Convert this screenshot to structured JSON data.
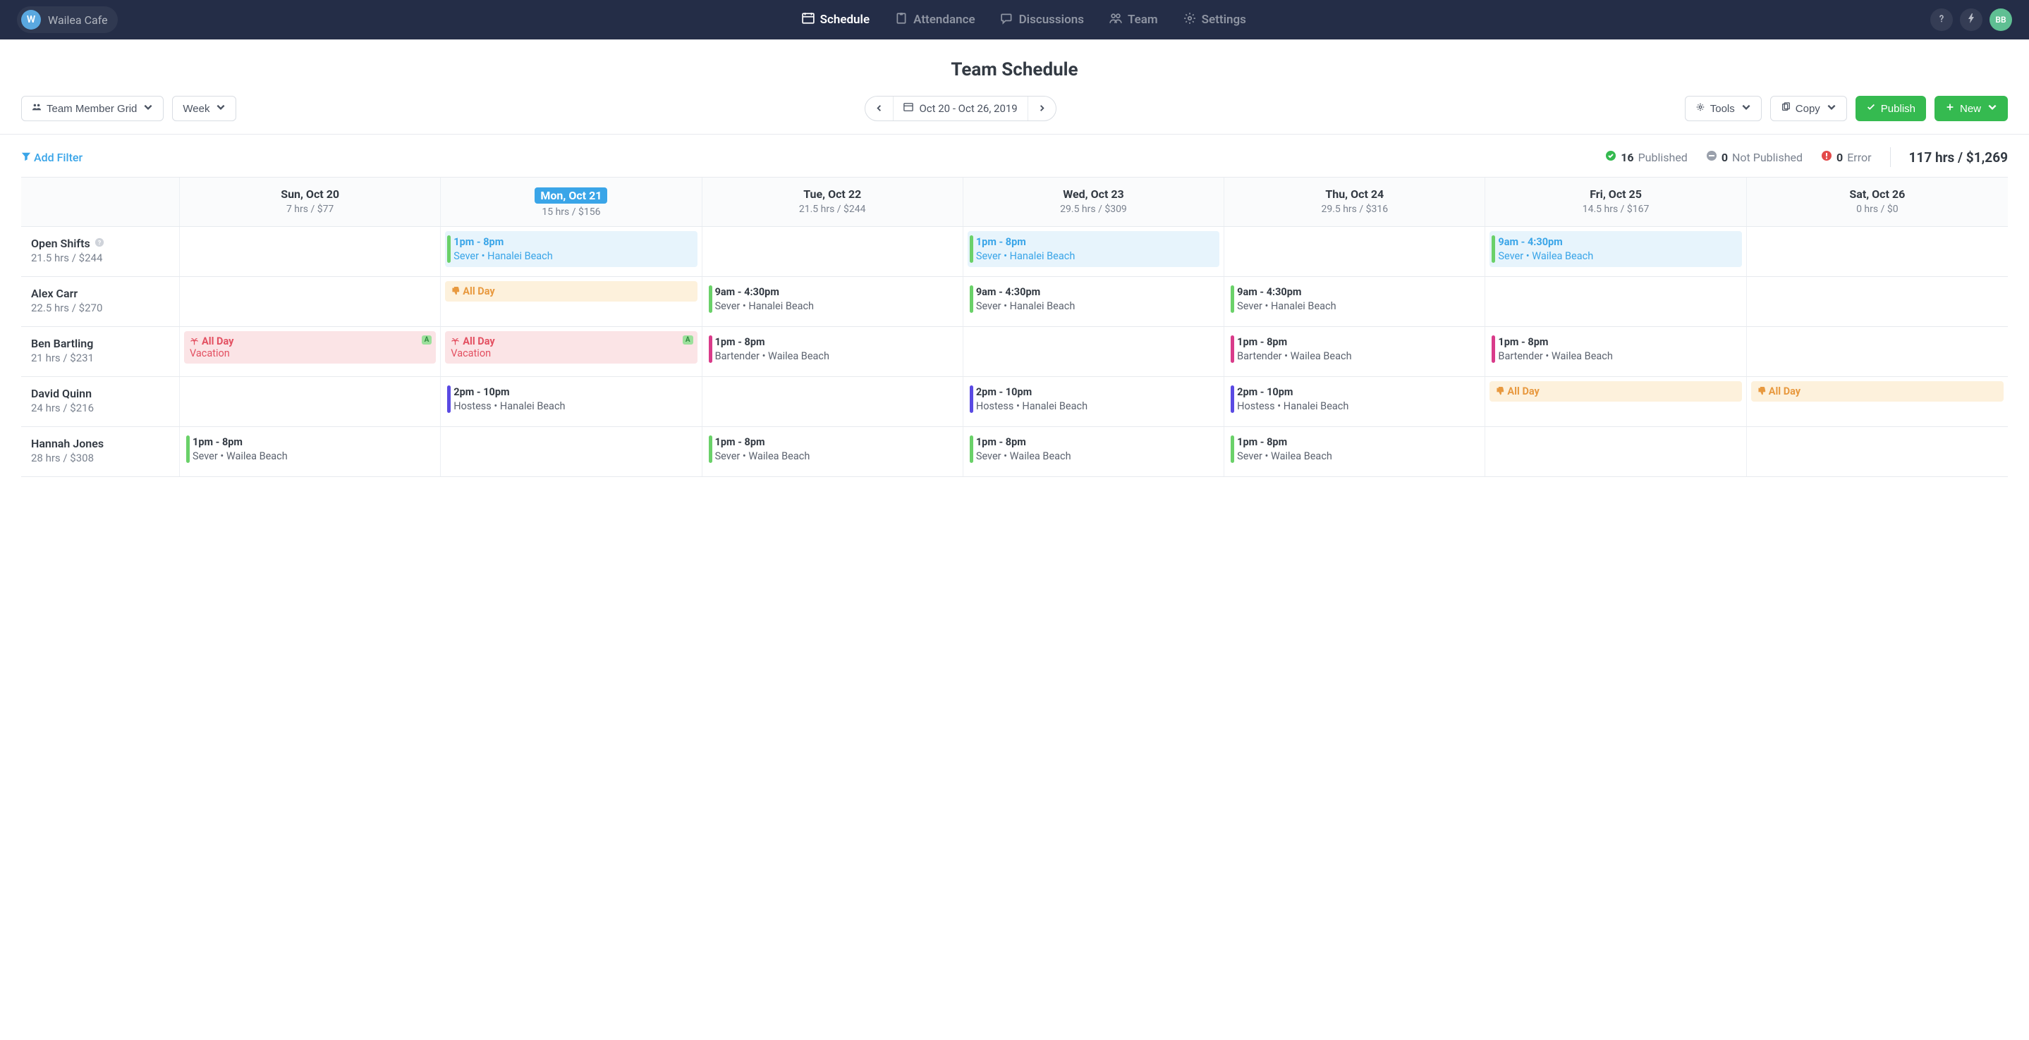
{
  "topbar": {
    "org_initial": "W",
    "org_name": "Wailea Cafe",
    "nav": {
      "schedule": "Schedule",
      "attendance": "Attendance",
      "discussions": "Discussions",
      "team": "Team",
      "settings": "Settings"
    },
    "user_initials": "BB"
  },
  "page": {
    "title": "Team Schedule"
  },
  "toolbar": {
    "view_mode": "Team Member Grid",
    "period": "Week",
    "date_range": "Oct 20 - Oct 26, 2019",
    "tools": "Tools",
    "copy": "Copy",
    "publish": "Publish",
    "new": "New"
  },
  "filter": {
    "add_filter": "Add Filter"
  },
  "stats": {
    "published_n": "16",
    "published_label": "Published",
    "not_published_n": "0",
    "not_published_label": "Not Published",
    "error_n": "0",
    "error_label": "Error",
    "totals": "117 hrs / $1,269"
  },
  "days": [
    {
      "label": "Sun, Oct 20",
      "stat": "7 hrs / $77",
      "today": false
    },
    {
      "label": "Mon, Oct 21",
      "stat": "15 hrs / $156",
      "today": true
    },
    {
      "label": "Tue, Oct 22",
      "stat": "21.5 hrs / $244",
      "today": false
    },
    {
      "label": "Wed, Oct 23",
      "stat": "29.5 hrs / $309",
      "today": false
    },
    {
      "label": "Thu, Oct 24",
      "stat": "29.5 hrs / $316",
      "today": false
    },
    {
      "label": "Fri, Oct 25",
      "stat": "14.5 hrs / $167",
      "today": false
    },
    {
      "label": "Sat, Oct 26",
      "stat": "0 hrs / $0",
      "today": false
    }
  ],
  "rows": [
    {
      "name": "Open Shifts",
      "help": true,
      "sub": "21.5 hrs / $244",
      "cells": [
        null,
        {
          "type": "open",
          "bar": "green",
          "time": "1pm - 8pm",
          "detail": "Sever • Hanalei Beach"
        },
        null,
        {
          "type": "open",
          "bar": "green",
          "time": "1pm - 8pm",
          "detail": "Sever • Hanalei Beach"
        },
        null,
        {
          "type": "open",
          "bar": "green",
          "time": "9am - 4:30pm",
          "detail": "Sever • Wailea Beach"
        },
        null
      ]
    },
    {
      "name": "Alex Carr",
      "sub": "22.5 hrs / $270",
      "cells": [
        null,
        {
          "type": "off",
          "time": "All Day"
        },
        {
          "type": "normal",
          "bar": "green",
          "time": "9am - 4:30pm",
          "detail": "Sever • Hanalei Beach"
        },
        {
          "type": "normal",
          "bar": "green",
          "time": "9am - 4:30pm",
          "detail": "Sever • Hanalei Beach"
        },
        {
          "type": "normal",
          "bar": "green",
          "time": "9am - 4:30pm",
          "detail": "Sever • Hanalei Beach"
        },
        null,
        null
      ]
    },
    {
      "name": "Ben Bartling",
      "sub": "21 hrs / $231",
      "cells": [
        {
          "type": "vac",
          "time": "All Day",
          "detail": "Vacation",
          "badge": "A"
        },
        {
          "type": "vac",
          "time": "All Day",
          "detail": "Vacation",
          "badge": "A"
        },
        {
          "type": "normal",
          "bar": "magenta",
          "time": "1pm - 8pm",
          "detail": "Bartender • Wailea Beach"
        },
        null,
        {
          "type": "normal",
          "bar": "magenta",
          "time": "1pm - 8pm",
          "detail": "Bartender • Wailea Beach"
        },
        {
          "type": "normal",
          "bar": "magenta",
          "time": "1pm - 8pm",
          "detail": "Bartender • Wailea Beach"
        },
        null
      ]
    },
    {
      "name": "David Quinn",
      "sub": "24 hrs / $216",
      "cells": [
        null,
        {
          "type": "normal",
          "bar": "indigo",
          "time": "2pm - 10pm",
          "detail": "Hostess • Hanalei Beach"
        },
        null,
        {
          "type": "normal",
          "bar": "indigo",
          "time": "2pm - 10pm",
          "detail": "Hostess • Hanalei Beach"
        },
        {
          "type": "normal",
          "bar": "indigo",
          "time": "2pm - 10pm",
          "detail": "Hostess • Hanalei Beach"
        },
        {
          "type": "off",
          "time": "All Day"
        },
        {
          "type": "off",
          "time": "All Day"
        }
      ]
    },
    {
      "name": "Hannah Jones",
      "sub": "28 hrs / $308",
      "cells": [
        {
          "type": "normal",
          "bar": "green",
          "time": "1pm - 8pm",
          "detail": "Sever • Wailea Beach"
        },
        null,
        {
          "type": "normal",
          "bar": "green",
          "time": "1pm - 8pm",
          "detail": "Sever • Wailea Beach"
        },
        {
          "type": "normal",
          "bar": "green",
          "time": "1pm - 8pm",
          "detail": "Sever • Wailea Beach"
        },
        {
          "type": "normal",
          "bar": "green",
          "time": "1pm - 8pm",
          "detail": "Sever • Wailea Beach"
        },
        null,
        null
      ]
    }
  ]
}
